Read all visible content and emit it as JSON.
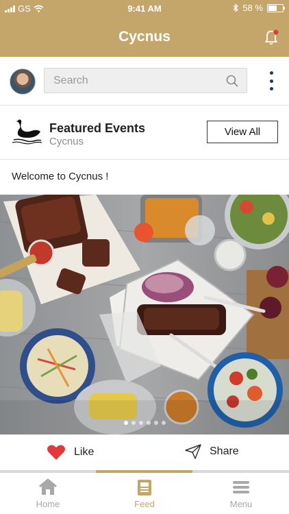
{
  "status": {
    "carrier": "GS",
    "time": "9:41 AM",
    "battery": "58 %",
    "battery_level": 0.58
  },
  "header": {
    "title": "Cycnus",
    "notification_dot": true
  },
  "search": {
    "placeholder": "Search"
  },
  "featured": {
    "title": "Featured Events",
    "subtitle": "Cycnus",
    "view_all_label": "View All"
  },
  "post": {
    "text": "Welcome to Cycnus !",
    "image_count": 6,
    "current_image": 1
  },
  "actions": {
    "like_label": "Like",
    "share_label": "Share"
  },
  "tabs": [
    {
      "label": "Home",
      "icon": "home-icon",
      "active": false
    },
    {
      "label": "Feed",
      "icon": "feed-icon",
      "active": true
    },
    {
      "label": "Menu",
      "icon": "menu-icon",
      "active": false
    }
  ],
  "colors": {
    "brand": "#c4a66b",
    "like": "#e0393e",
    "kebab": "#1e3a5f"
  }
}
